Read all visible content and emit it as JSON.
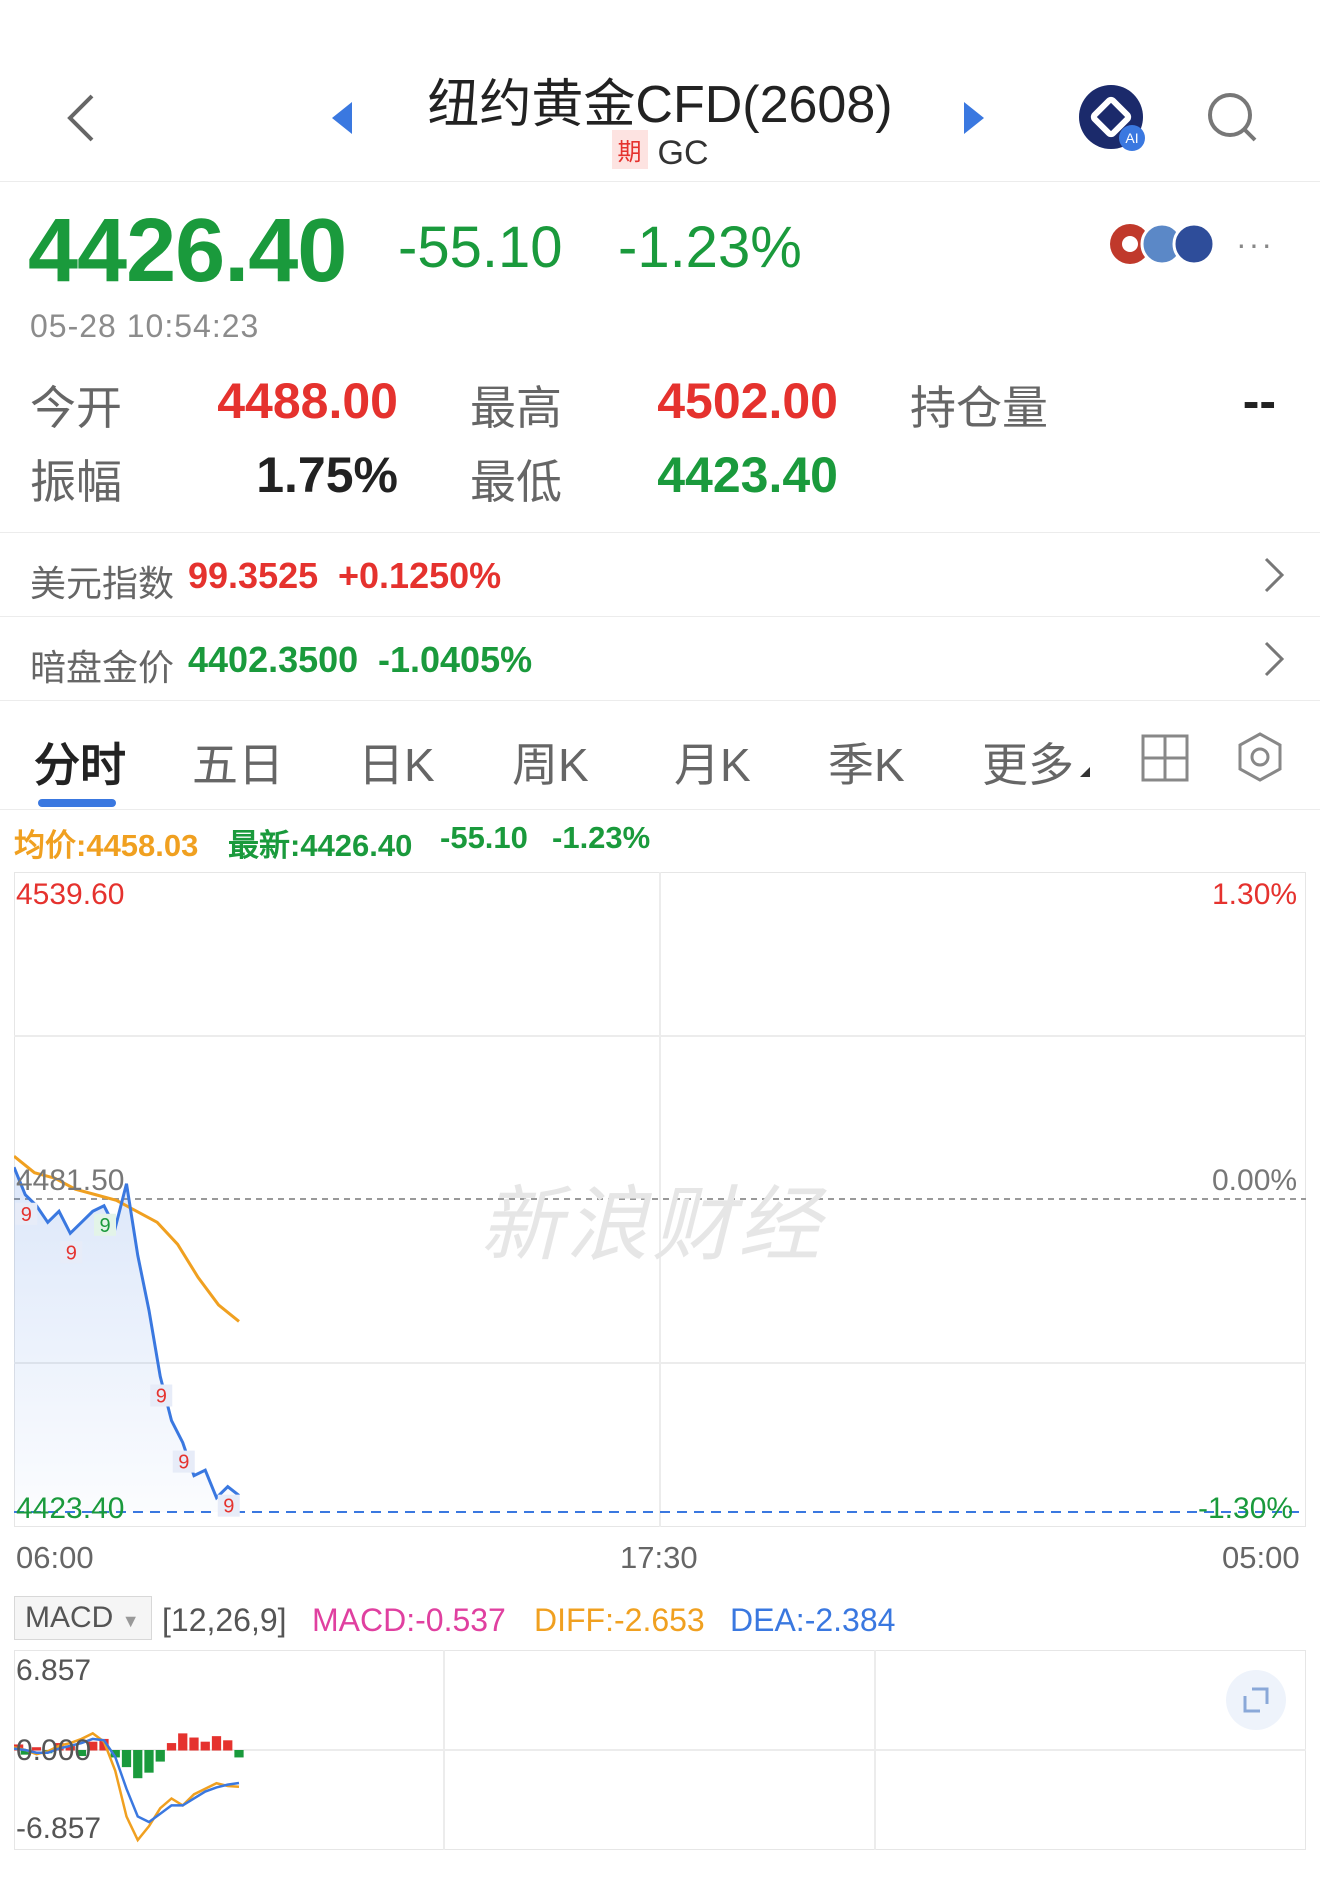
{
  "header": {
    "title": "纽约黄金CFD(2608)",
    "badge": "期",
    "symbol": "GC"
  },
  "quote": {
    "price": "4426.40",
    "change": "-55.10",
    "change_pct": "-1.23%",
    "timestamp": "05-28 10:54:23"
  },
  "stats": {
    "open_label": "今开",
    "open": "4488.00",
    "high_label": "最高",
    "high": "4502.00",
    "oi_label": "持仓量",
    "oi": "--",
    "amp_label": "振幅",
    "amp": "1.75%",
    "low_label": "最低",
    "low": "4423.40"
  },
  "links": [
    {
      "label": "美元指数",
      "value": "99.3525",
      "pct": "+0.1250%"
    },
    {
      "label": "暗盘金价",
      "value": "4402.3500",
      "pct": "-1.0405%"
    }
  ],
  "tabs": [
    "分时",
    "五日",
    "日K",
    "周K",
    "月K",
    "季K",
    "更多"
  ],
  "info_line": {
    "avg": "均价:4458.03",
    "latest": "最新:4426.40",
    "chg": "-55.10",
    "pct": "-1.23%"
  },
  "chart_labels": {
    "top_left": "4539.60",
    "top_right": "1.30%",
    "mid_left": "4481.50",
    "mid_right": "0.00%",
    "bottom_left": "4423.40",
    "bottom_right": "-1.30%",
    "watermark": "新浪财经",
    "time_start": "06:00",
    "time_mid": "17:30",
    "time_end": "05:00"
  },
  "chart_data": {
    "type": "line",
    "x_labels": [
      "06:00",
      "17:30",
      "05:00"
    ],
    "ylim": [
      4423.4,
      4539.6
    ],
    "baseline": 4481.5,
    "series": [
      {
        "name": "均价",
        "values": [
          4488,
          4485,
          4484,
          4482,
          4481,
          4480,
          4478,
          4476,
          4472,
          4466,
          4461,
          4458
        ]
      },
      {
        "name": "最新",
        "values": [
          4486,
          4481,
          4479,
          4476,
          4478,
          4474,
          4476,
          4478,
          4479,
          4475,
          4483,
          4470,
          4460,
          4448,
          4440,
          4436,
          4430,
          4431,
          4426,
          4428,
          4426.4
        ]
      }
    ],
    "markers": [
      "9",
      "9",
      "9",
      "9",
      "9",
      "9"
    ],
    "colors": {
      "price": "#3a78e0",
      "avg": "#f0a020",
      "up": "#e5322e",
      "down": "#1a9a3c"
    }
  },
  "macd": {
    "select_label": "MACD",
    "params": "[12,26,9]",
    "macd": "MACD:-0.537",
    "diff": "DIFF:-2.653",
    "dea": "DEA:-2.384",
    "top": "6.857",
    "zero": "0.000",
    "bottom": "-6.857",
    "histogram": [
      0.4,
      -0.3,
      0.2,
      -0.2,
      0.5,
      0.3,
      -0.4,
      0.6,
      0.8,
      -0.5,
      -1.2,
      -2.0,
      -1.6,
      -0.8,
      0.5,
      1.2,
      0.9,
      0.6,
      1.0,
      0.7,
      -0.5
    ],
    "diff_values": [
      0.2,
      0.0,
      -0.3,
      -0.1,
      0.3,
      0.5,
      0.8,
      1.2,
      0.6,
      -1.5,
      -4.8,
      -6.5,
      -5.5,
      -4.2,
      -3.5,
      -4.0,
      -3.2,
      -2.8,
      -2.4,
      -2.6,
      -2.65
    ],
    "dea_values": [
      0.1,
      0.0,
      -0.2,
      -0.2,
      0.1,
      0.3,
      0.5,
      0.8,
      0.7,
      -0.5,
      -2.8,
      -4.8,
      -5.2,
      -4.6,
      -4.0,
      -4.0,
      -3.5,
      -3.0,
      -2.7,
      -2.5,
      -2.38
    ]
  }
}
